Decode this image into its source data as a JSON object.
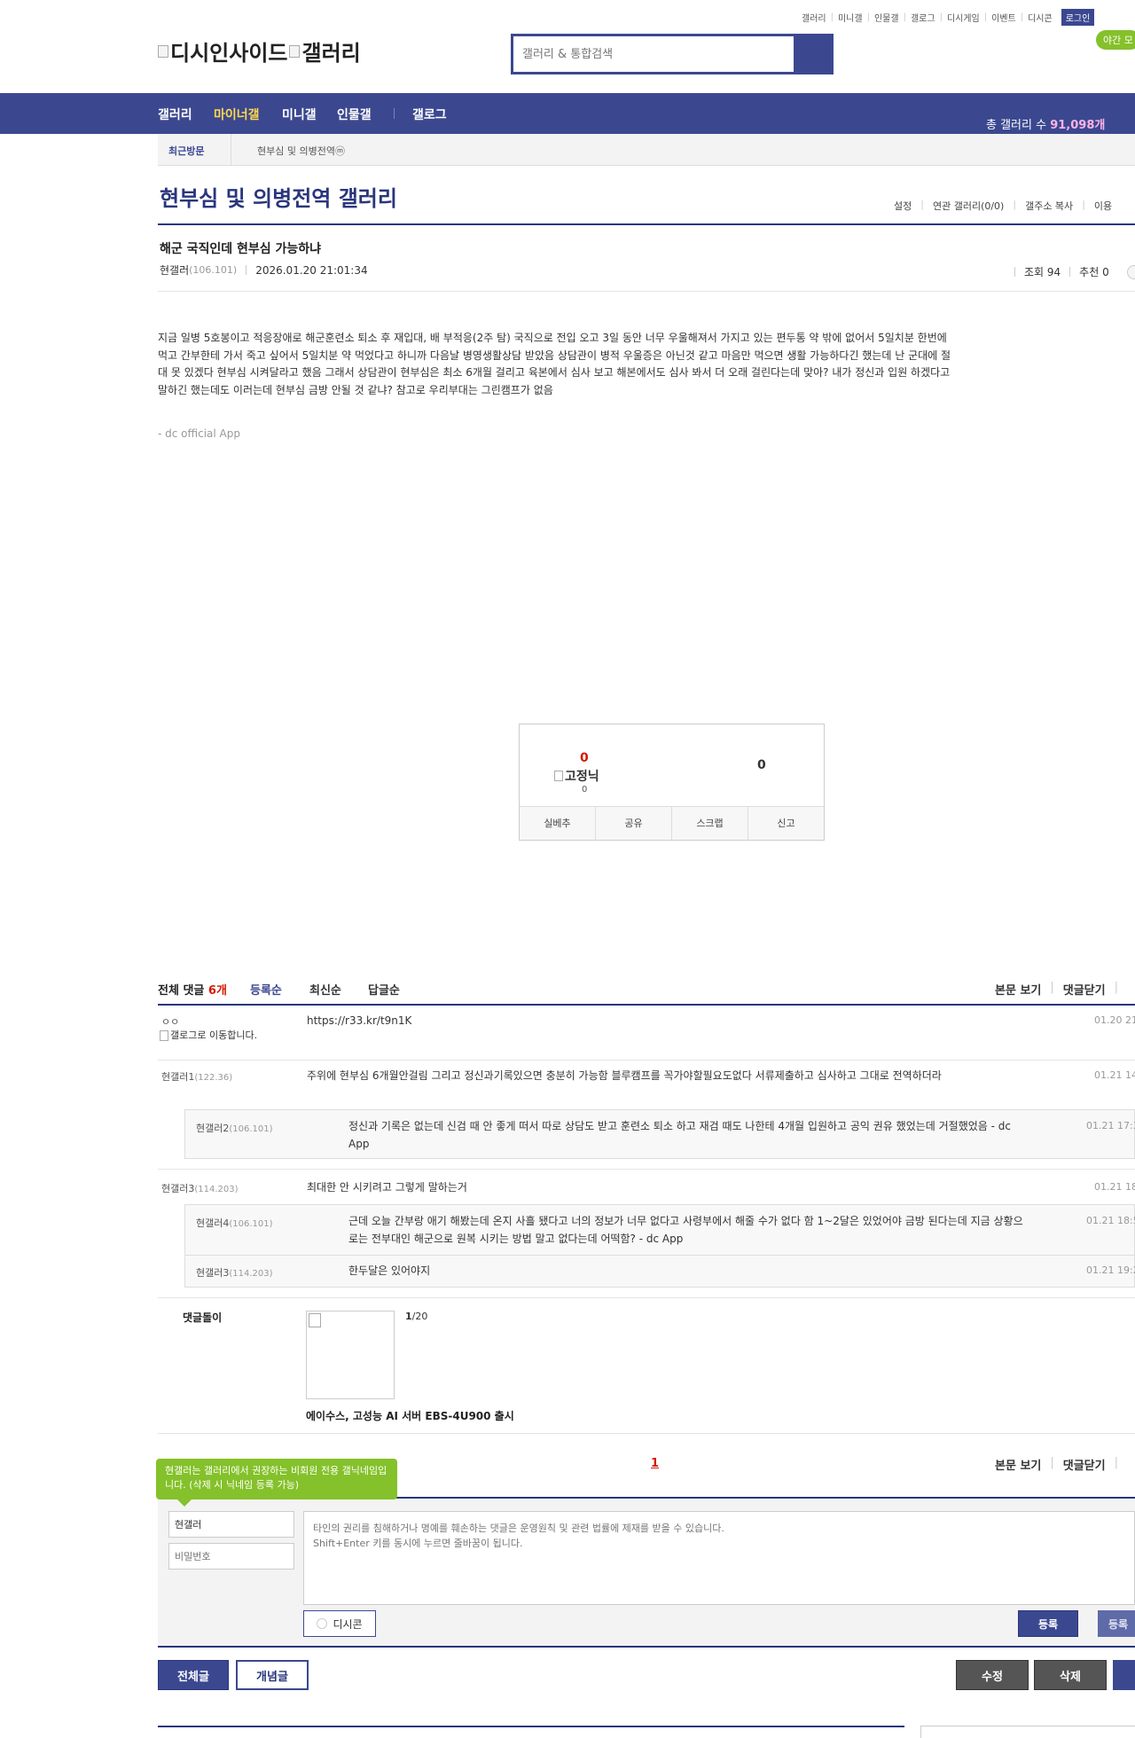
{
  "util_menu": [
    "갤러리",
    "미니갤",
    "인물갤",
    "갤로그",
    "디시게임",
    "이벤트",
    "디시콘"
  ],
  "login_label": "로그인",
  "night_mode_label": "야간 모",
  "logo": {
    "part1": "디시인사이드",
    "part2": "갤러리"
  },
  "search": {
    "placeholder": "갤러리 & 통합검색"
  },
  "gnb": {
    "items": [
      "갤러리",
      "마이너갤",
      "미니갤",
      "인물갤",
      "갤로그"
    ],
    "total_label": "총 갤러리 수 ",
    "total_value": "91,098개"
  },
  "recent_visit": {
    "label": "최근방문",
    "gallery": "현부심 및 의병전역ⓜ"
  },
  "gallery_title": "현부심 및 의병전역 갤러리",
  "gallery_menu": [
    "설정",
    "연관 갤러리(0/0)",
    "갤주소 복사",
    "이용"
  ],
  "post": {
    "title": "해군 국직인데 현부심 가능하냐",
    "author": "현갤러",
    "ip": "(106.101)",
    "date": "2026.01.20 21:01:34",
    "views_label": "조회 94",
    "recommend_label": "추천 0",
    "body": "지금 일병 5호봉이고 적응장애로 해군훈련소 퇴소 후 재입대, 배 부적응(2주 탐) 국직으로 전입 오고 3일 동안 너무 우울해져서  가지고 있는 편두통 약 밖에 없어서 5일치분 한번에 먹고 간부한테 가서 죽고 싶어서 5일치분 약 먹었다고 하니까 다음날 병영생활상담 받았음 상담관이 병적 우울증은 아닌것 같고 마음만 먹으면 생활 가능하다긴 했는데 난 군대에 절대 못 있겠다 현부심 시켜달라고 했음 그래서 상담관이 현부심은 최소 6개월 걸리고 육본에서 심사 보고 해본에서도 심사 봐서 더 오래 걸린다는데 맞아? 내가 정신과 입원 하겠다고 말하긴 했는데도 이러는데 현부심 금방 안될 것 같냐? 참고로 우리부대는 그린캠프가 없음",
    "signature": "- dc official App"
  },
  "recommend": {
    "up_count": "0",
    "fixed_label": "고정닉",
    "fixed_count": "0",
    "down_count": "0",
    "buttons": [
      "실베추",
      "공유",
      "스크랩",
      "신고"
    ]
  },
  "comments_bar": {
    "total_label": "전체 댓글 ",
    "total_count": "6개",
    "sorts": [
      "등록순",
      "최신순",
      "답글순"
    ],
    "right": [
      "본문 보기",
      "댓글닫기"
    ]
  },
  "comments": [
    {
      "nick": "ㅇㅇ",
      "gallog_alt": "갤로그로 이동합니다.",
      "text": "https://r33.kr/t9n1K",
      "date": "01.20 21"
    },
    {
      "nick": "현갤러1",
      "ip": "(122.36)",
      "text": "주위에 현부심 6개월안걸림 그리고 정신과기록있으면 충분히 가능함 블루캠프를 꼭가야할필요도없다 서류제출하고 심사하고 그대로 전역하더라",
      "date": "01.21 14"
    },
    {
      "nick": "현갤러2",
      "ip": "(106.101)",
      "text": "정신과 기록은 없는데 신검 때 안 좋게 떠서 따로 상담도 받고 훈련소 퇴소 하고 재검 때도 나한테 4개월 입원하고 공익 권유 했었는데 거절했었음 - dc App",
      "date": "01.21 17:3",
      "reply": true
    },
    {
      "nick": "현갤러3",
      "ip": "(114.203)",
      "text": "최대한 안 시키려고 그렇게 말하는거",
      "date": "01.21 18"
    },
    {
      "nick": "현갤러4",
      "ip": "(106.101)",
      "text": "근데 오늘 간부랑 애기 해봤는데 온지 사흘 됐다고 너의 정보가 너무 없다고 사령부에서 해줄 수가 없다 함 1~2달은 있었어야 금방 된다는데 지금 상황으로는 전부대인 해군으로 원복 시키는 방법 말고 없다는데 어떡함? - dc App",
      "date": "01.21 18:5",
      "reply": true
    },
    {
      "nick": "현갤러3",
      "ip": "(114.203)",
      "text": "한두달은 있어야지",
      "date": "01.21 19:2",
      "reply": true
    }
  ],
  "dolbot": {
    "label": "댓글돌이",
    "page_current": "1",
    "page_total": "/20",
    "title": "에이수스, 고성능 AI 서버 EBS-4U900 출시"
  },
  "pager": "1",
  "tooltip": "현갤러는 갤러리에서 권장하는 비회원 전용 갤닉네임입니다. (삭제 시 닉네임 등록 가능)",
  "write": {
    "nick_value": "현갤러",
    "pw_placeholder": "비밀번호",
    "textarea_placeholder": "타인의 권리를 침해하거나 명예를 훼손하는 댓글은 운영원칙 및 관련 법률에 제재를 받을 수 있습니다.\nShift+Enter 키를 동시에 누르면 줄바꿈이 됩니다.",
    "dccon_label": "디시콘",
    "submit_label": "등록",
    "submit2_label": "등록"
  },
  "bottom_buttons": {
    "all": "전체글",
    "concept": "개념글",
    "edit": "수정",
    "delete": "삭제"
  },
  "colors": {
    "primary": "#3b4890",
    "dark": "#29367c",
    "accent_red": "#d31900",
    "green": "#84c12a",
    "gnb_active": "#ffd84a"
  }
}
